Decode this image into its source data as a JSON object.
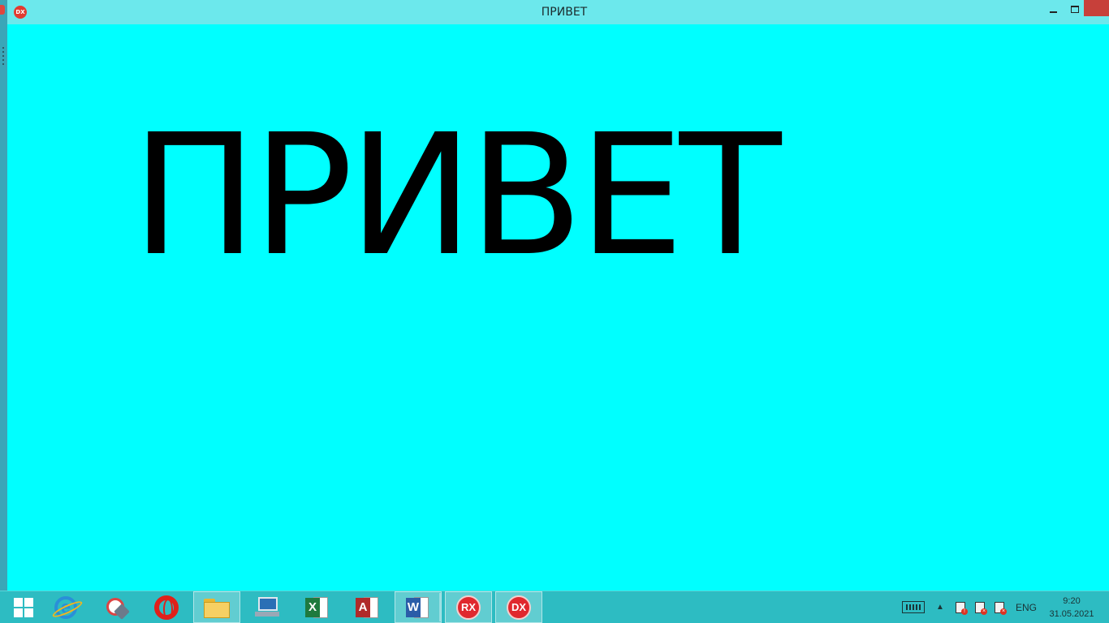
{
  "window": {
    "title": "ПРИВЕТ",
    "icon_label": "DX"
  },
  "content": {
    "label_text": "ПРИВЕТ",
    "background_color": "#00ffff"
  },
  "taskbar": {
    "pinned": [
      {
        "name": "start-button",
        "icon": "windows-logo-icon"
      },
      {
        "name": "internet-explorer",
        "icon": "internet-explorer-icon"
      },
      {
        "name": "tools",
        "icon": "tools-icon"
      },
      {
        "name": "opera",
        "icon": "opera-icon"
      },
      {
        "name": "file-explorer",
        "icon": "folder-icon",
        "active": true
      },
      {
        "name": "computer",
        "icon": "computer-icon"
      },
      {
        "name": "excel",
        "icon": "excel-icon",
        "label": "X"
      },
      {
        "name": "access",
        "icon": "access-icon",
        "label": "A"
      },
      {
        "name": "word",
        "icon": "word-icon",
        "label": "W"
      },
      {
        "name": "rad-studio-rx",
        "icon": "rx-icon",
        "label": "RX"
      },
      {
        "name": "rad-studio-dx",
        "icon": "dx-icon",
        "label": "DX",
        "active": true
      }
    ],
    "tray": {
      "language": "ENG",
      "time": "9:20",
      "date": "31.05.2021"
    }
  }
}
